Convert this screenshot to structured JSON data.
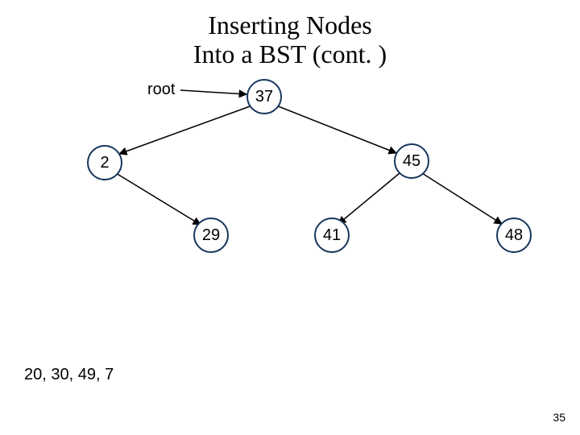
{
  "title": {
    "line1": "Inserting Nodes",
    "line2": "Into a BST (cont. )"
  },
  "root_label": "root",
  "tree": {
    "root": {
      "value": "37"
    },
    "left": {
      "value": "2",
      "right": {
        "value": "29"
      }
    },
    "right": {
      "value": "45",
      "left": {
        "value": "41"
      },
      "right": {
        "value": "48"
      }
    }
  },
  "pending_insertions": "20, 30, 49, 7",
  "page_number": "35"
}
